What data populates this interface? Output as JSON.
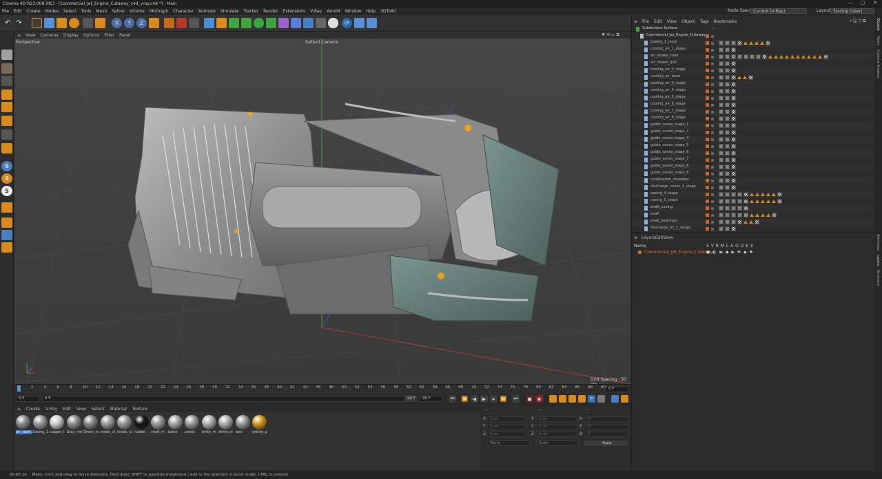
{
  "title": "Cinema 4D R23.008 (RC) - [Commercial_Jet_Engine_Cutaway_c4d_vray.c4d *] - Main",
  "window_controls": [
    "—",
    "▢",
    "✕"
  ],
  "menu": [
    "File",
    "Edit",
    "Create",
    "Modes",
    "Select",
    "Tools",
    "Mesh",
    "Spline",
    "Volume",
    "MoGraph",
    "Character",
    "Animate",
    "Simulate",
    "Tracker",
    "Render",
    "Extensions",
    "V-Ray",
    "Arnold",
    "Window",
    "Help",
    "3DToAll"
  ],
  "node_space": {
    "label": "Node Space:",
    "value": "Current (V-Ray)"
  },
  "layout": {
    "label": "Layout:",
    "value": "Startup (User)"
  },
  "viewport_menu": [
    "View",
    "Cameras",
    "Display",
    "Options",
    "Filter",
    "Panel"
  ],
  "viewport": {
    "name": "Perspective",
    "camera": "Default Camera",
    "grid_spacing": "Grid Spacing : 50 cm"
  },
  "timeline": {
    "ticks": [
      "0",
      "2",
      "4",
      "6",
      "8",
      "10",
      "12",
      "14",
      "16",
      "18",
      "20",
      "22",
      "24",
      "26",
      "28",
      "30",
      "32",
      "34",
      "36",
      "38",
      "40",
      "42",
      "44",
      "46",
      "48",
      "50",
      "52",
      "54",
      "56",
      "58",
      "60",
      "62",
      "64",
      "66",
      "68",
      "70",
      "72",
      "74",
      "76",
      "78",
      "80",
      "82",
      "84",
      "86",
      "88",
      "90"
    ],
    "frame_end": "0 F"
  },
  "playbar": {
    "start": "0 F",
    "current": "0 F",
    "end": "90 F",
    "end2": "90 F"
  },
  "material_menu": [
    "Create",
    "V-Ray",
    "Edit",
    "View",
    "Select",
    "Material",
    "Texture"
  ],
  "materials": [
    {
      "name": "air_cond",
      "color": "#8c8c8c"
    },
    {
      "name": "Casing_1",
      "color": "#9a9a9a"
    },
    {
      "name": "copper_l",
      "color": "#cfcfcf"
    },
    {
      "name": "Gray_me",
      "color": "#8d8d8d"
    },
    {
      "name": "Green_m",
      "color": "#888888"
    },
    {
      "name": "inside_cl",
      "color": "#9a9a9a"
    },
    {
      "name": "inside_cl",
      "color": "#9a9a9a"
    },
    {
      "name": "rubber",
      "color": "#151515"
    },
    {
      "name": "shaft_m",
      "color": "#9a9a9a"
    },
    {
      "name": "tubes",
      "color": "#a5a5a5"
    },
    {
      "name": "vanes",
      "color": "#9c9c9c"
    },
    {
      "name": "white_m",
      "color": "#b0b0b0"
    },
    {
      "name": "white_pl",
      "color": "#b0b0b0"
    },
    {
      "name": "wire",
      "color": "#9a9a9a"
    },
    {
      "name": "yellow_p",
      "color": "#d89a1c"
    }
  ],
  "coords": {
    "header1": "--",
    "header2": "--",
    "header3": "--",
    "labels": [
      "X",
      "Y",
      "Z"
    ],
    "size_labels": [
      "X",
      "Y",
      "Z"
    ],
    "rot_labels": [
      "H",
      "P",
      "B"
    ],
    "pos": [
      "0 cm",
      "0 cm",
      "0 cm"
    ],
    "size": [
      "0 cm",
      "0 cm",
      "0 cm"
    ],
    "rot": [
      "0 °",
      "0 °",
      "0 °"
    ],
    "mode1": "World",
    "mode2": "Scale",
    "apply": "Apply"
  },
  "status": {
    "time": "00:00:10",
    "message": "Move: Click and drag to move elements. Hold down SHIFT to quantize movement / add to the selection in point mode, CTRL to remove."
  },
  "object_menu": [
    "File",
    "Edit",
    "View",
    "Object",
    "Tags",
    "Bookmarks"
  ],
  "objects": [
    {
      "name": "Subdivision Surface",
      "tags": 0,
      "tri": 0
    },
    {
      "name": "Commercial_Jet_Engine_Cutaway",
      "tags": 0,
      "tri": 0
    },
    {
      "name": "Casing_1_level",
      "tags": 3,
      "tri": 4
    },
    {
      "name": "cooling_air_1_stage",
      "tags": 2,
      "tri": 0
    },
    {
      "name": "air_intake_cone",
      "tags": 7,
      "tri": 10
    },
    {
      "name": "air_intake_grill",
      "tags": 2,
      "tri": 0
    },
    {
      "name": "cooling_air_2_stage",
      "tags": 2,
      "tri": 0
    },
    {
      "name": "cooling_air_base",
      "tags": 2,
      "tri": 2
    },
    {
      "name": "cooling_air_3_stage",
      "tags": 2,
      "tri": 0
    },
    {
      "name": "cooling_air_4_stage",
      "tags": 2,
      "tri": 0
    },
    {
      "name": "cooling_air_5_stage",
      "tags": 2,
      "tri": 0
    },
    {
      "name": "cooling_air_6_stage",
      "tags": 2,
      "tri": 0
    },
    {
      "name": "cooling_air_7_stage",
      "tags": 2,
      "tri": 0
    },
    {
      "name": "cooling_air_8_stage",
      "tags": 2,
      "tri": 0
    },
    {
      "name": "guide_vanes_stage_1",
      "tags": 2,
      "tri": 0
    },
    {
      "name": "guide_vanes_stage_2",
      "tags": 2,
      "tri": 0
    },
    {
      "name": "guide_vanes_stage_4",
      "tags": 2,
      "tri": 0
    },
    {
      "name": "guide_vanes_stage_5",
      "tags": 2,
      "tri": 0
    },
    {
      "name": "guide_vanes_stage_6",
      "tags": 2,
      "tri": 0
    },
    {
      "name": "guide_vanes_stage_7",
      "tags": 2,
      "tri": 0
    },
    {
      "name": "guide_vanes_stage_8",
      "tags": 2,
      "tri": 0
    },
    {
      "name": "guide_vanes_stage_8",
      "tags": 2,
      "tri": 0
    },
    {
      "name": "combustion_chamber",
      "tags": 2,
      "tri": 0
    },
    {
      "name": "discharge_vanes_1_stage",
      "tags": 2,
      "tri": 0
    },
    {
      "name": "casing_4_stage",
      "tags": 4,
      "tri": 5
    },
    {
      "name": "casing_5_stage",
      "tags": 4,
      "tri": 5
    },
    {
      "name": "shaft_casing",
      "tags": 4,
      "tri": 0
    },
    {
      "name": "shaft",
      "tags": 4,
      "tri": 4
    },
    {
      "name": "shaft_bearings",
      "tags": 3,
      "tri": 2
    },
    {
      "name": "discharge_air_1_stage",
      "tags": 2,
      "tri": 0
    }
  ],
  "layer_menu": [
    "Layers",
    "Edit",
    "View"
  ],
  "layer_header": {
    "name": "Name",
    "flags": "S V R M L A G D E X"
  },
  "layers": [
    {
      "name": "Commercial_Jet_Engine_Cutaway"
    }
  ],
  "right_tabs": [
    "Objects",
    "Takes",
    "Content Browser",
    "Attributes",
    "Layers",
    "Structure"
  ]
}
